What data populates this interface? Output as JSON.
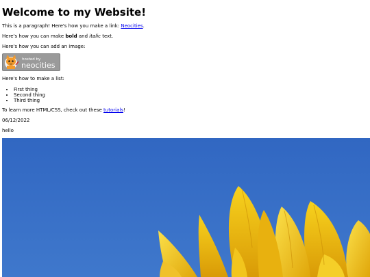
{
  "header": {
    "title": "Welcome to my Website!"
  },
  "para1": {
    "before": "This is a paragraph! Here's how you make a link: ",
    "link": "Neocities",
    "after": "."
  },
  "para2": {
    "before": "Here's how you can make ",
    "bold": "bold",
    "middle": " and ",
    "italic": "italic",
    "after": " text."
  },
  "para3": {
    "text": "Here's how you can add an image:"
  },
  "badge": {
    "small_text": "hosted by",
    "brand_text": "neocities",
    "icon": "neocities-cat-icon"
  },
  "para4": {
    "text": "Here's how to make a list:"
  },
  "list": {
    "items": [
      "First thing",
      "Second thing",
      "Third thing"
    ]
  },
  "para5": {
    "before": "To learn more HTML/CSS, check out these ",
    "link": "tutorials",
    "after": "!"
  },
  "date": {
    "text": "06/12/2022"
  },
  "greeting": {
    "text": "hello"
  },
  "photo": {
    "subject": "sunflower-petals-against-blue-sky",
    "sky_color": "#3a6fc4",
    "petal_color": "#f3c51b"
  }
}
